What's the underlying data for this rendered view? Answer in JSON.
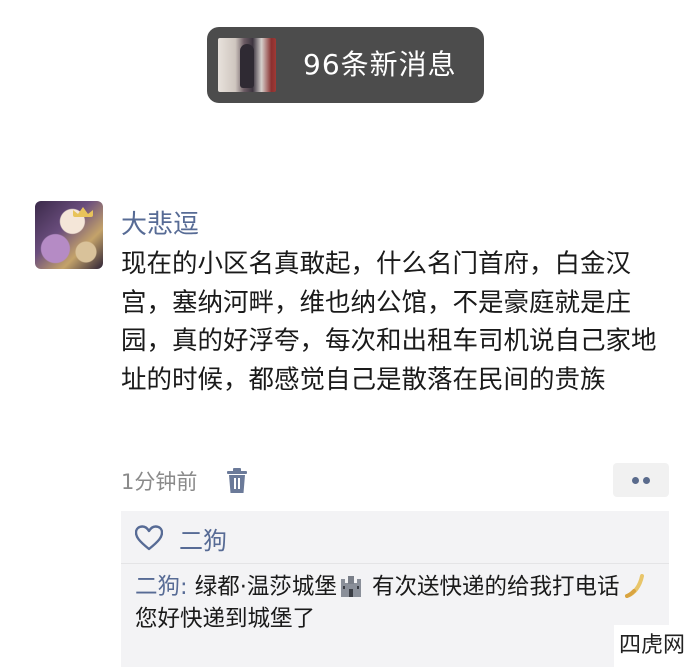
{
  "notification": {
    "text": "96条新消息"
  },
  "post": {
    "author": "大悲逗",
    "text": "现在的小区名真敢起，什么名门首府，白金汉宫，塞纳河畔，维也纳公馆，不是豪庭就是庄园，真的好浮夸，每次和出租车司机说自己家地址的时候，都感觉自己是散落在民间的贵族",
    "time": "1分钟前"
  },
  "likes": {
    "names": "二狗"
  },
  "comments": [
    {
      "author": "二狗:",
      "text_part1": " 绿都·温莎城堡",
      "text_part2": " 有次送快递的给我打电话",
      "text_part3": " 您好快递到城堡了"
    }
  ],
  "watermark": "四虎网",
  "icons": {
    "trash": "trash-icon",
    "more": "more-dots-icon",
    "heart": "heart-outline-icon",
    "castle": "castle-emoji-icon",
    "phone": "phone-emoji-icon"
  },
  "colors": {
    "name_blue": "#576b95",
    "notification_bg": "#4c4c4c",
    "comment_bg": "#f3f3f5"
  }
}
